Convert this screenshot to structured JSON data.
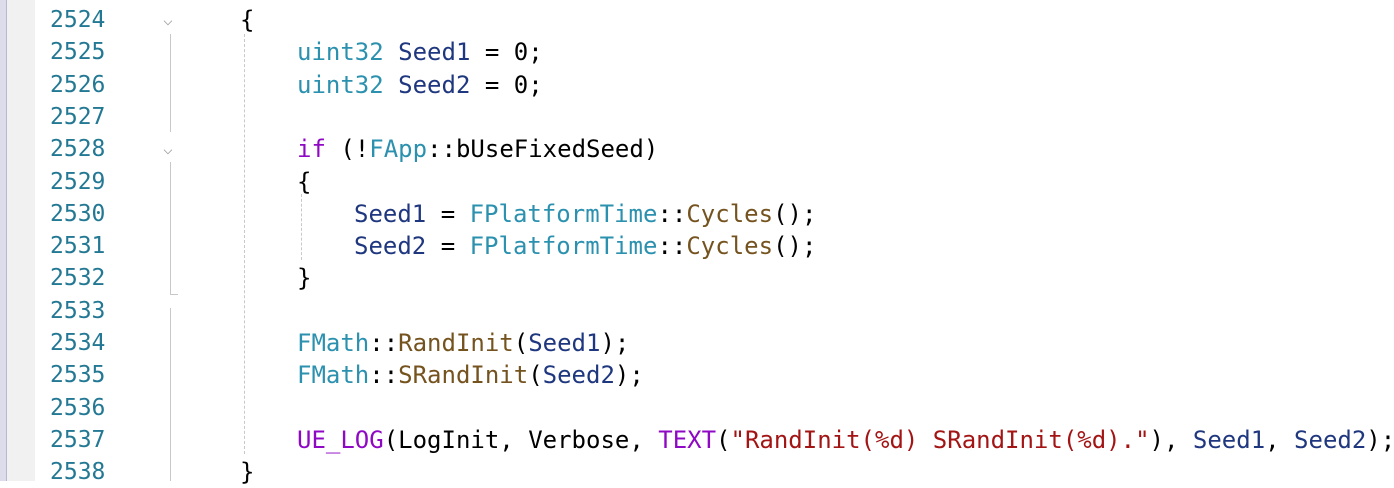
{
  "colors": {
    "line_number": "#237893",
    "punctuation": "#000000",
    "type": "#2b91af",
    "keyword": "#8f08c4",
    "identifier": "#1f377f",
    "function": "#74531f",
    "string": "#a31515",
    "gutter": "#f1f1f1",
    "left_margin": "#dcdcec"
  },
  "icons": {
    "fold": "chevron-down-icon"
  },
  "editor": {
    "lines": [
      {
        "number": "2524",
        "fold": "⌵",
        "indent": 0,
        "tokens": [
          {
            "t": "{",
            "c": "punc"
          }
        ]
      },
      {
        "number": "2525",
        "fold": "",
        "indent": 1,
        "tokens": [
          {
            "t": "uint32",
            "c": "type"
          },
          {
            "t": " ",
            "c": "punc"
          },
          {
            "t": "Seed1",
            "c": "id"
          },
          {
            "t": " = 0;",
            "c": "punc"
          }
        ]
      },
      {
        "number": "2526",
        "fold": "",
        "indent": 1,
        "tokens": [
          {
            "t": "uint32",
            "c": "type"
          },
          {
            "t": " ",
            "c": "punc"
          },
          {
            "t": "Seed2",
            "c": "id"
          },
          {
            "t": " = 0;",
            "c": "punc"
          }
        ]
      },
      {
        "number": "2527",
        "fold": "",
        "indent": 0,
        "tokens": []
      },
      {
        "number": "2528",
        "fold": "⌵",
        "indent": 1,
        "tokens": [
          {
            "t": "if",
            "c": "kw"
          },
          {
            "t": " (!",
            "c": "punc"
          },
          {
            "t": "FApp",
            "c": "type"
          },
          {
            "t": "::",
            "c": "punc"
          },
          {
            "t": "bUseFixedSeed",
            "c": "punc"
          },
          {
            "t": ")",
            "c": "punc"
          }
        ]
      },
      {
        "number": "2529",
        "fold": "",
        "indent": 1,
        "tokens": [
          {
            "t": "{",
            "c": "punc"
          }
        ]
      },
      {
        "number": "2530",
        "fold": "",
        "indent": 2,
        "tokens": [
          {
            "t": "Seed1",
            "c": "id"
          },
          {
            "t": " = ",
            "c": "punc"
          },
          {
            "t": "FPlatformTime",
            "c": "type"
          },
          {
            "t": "::",
            "c": "punc"
          },
          {
            "t": "Cycles",
            "c": "fn"
          },
          {
            "t": "();",
            "c": "punc"
          }
        ]
      },
      {
        "number": "2531",
        "fold": "",
        "indent": 2,
        "tokens": [
          {
            "t": "Seed2",
            "c": "id"
          },
          {
            "t": " = ",
            "c": "punc"
          },
          {
            "t": "FPlatformTime",
            "c": "type"
          },
          {
            "t": "::",
            "c": "punc"
          },
          {
            "t": "Cycles",
            "c": "fn"
          },
          {
            "t": "();",
            "c": "punc"
          }
        ]
      },
      {
        "number": "2532",
        "fold": "",
        "indent": 1,
        "tokens": [
          {
            "t": "}",
            "c": "punc"
          }
        ]
      },
      {
        "number": "2533",
        "fold": "",
        "indent": 0,
        "tokens": []
      },
      {
        "number": "2534",
        "fold": "",
        "indent": 1,
        "tokens": [
          {
            "t": "FMath",
            "c": "type"
          },
          {
            "t": "::",
            "c": "punc"
          },
          {
            "t": "RandInit",
            "c": "fn"
          },
          {
            "t": "(",
            "c": "punc"
          },
          {
            "t": "Seed1",
            "c": "id"
          },
          {
            "t": ");",
            "c": "punc"
          }
        ]
      },
      {
        "number": "2535",
        "fold": "",
        "indent": 1,
        "tokens": [
          {
            "t": "FMath",
            "c": "type"
          },
          {
            "t": "::",
            "c": "punc"
          },
          {
            "t": "SRandInit",
            "c": "fn"
          },
          {
            "t": "(",
            "c": "punc"
          },
          {
            "t": "Seed2",
            "c": "id"
          },
          {
            "t": ");",
            "c": "punc"
          }
        ]
      },
      {
        "number": "2536",
        "fold": "",
        "indent": 0,
        "tokens": []
      },
      {
        "number": "2537",
        "fold": "",
        "indent": 1,
        "tokens": [
          {
            "t": "UE_LOG",
            "c": "kw"
          },
          {
            "t": "(LogInit, Verbose, ",
            "c": "punc"
          },
          {
            "t": "TEXT",
            "c": "kw"
          },
          {
            "t": "(",
            "c": "punc"
          },
          {
            "t": "\"RandInit(%d) SRandInit(%d).\"",
            "c": "str"
          },
          {
            "t": "), ",
            "c": "punc"
          },
          {
            "t": "Seed1",
            "c": "id"
          },
          {
            "t": ", ",
            "c": "punc"
          },
          {
            "t": "Seed2",
            "c": "id"
          },
          {
            "t": ");",
            "c": "punc"
          }
        ]
      },
      {
        "number": "2538",
        "fold": "",
        "indent": 0,
        "tokens": [
          {
            "t": "}",
            "c": "punc"
          }
        ]
      }
    ]
  }
}
